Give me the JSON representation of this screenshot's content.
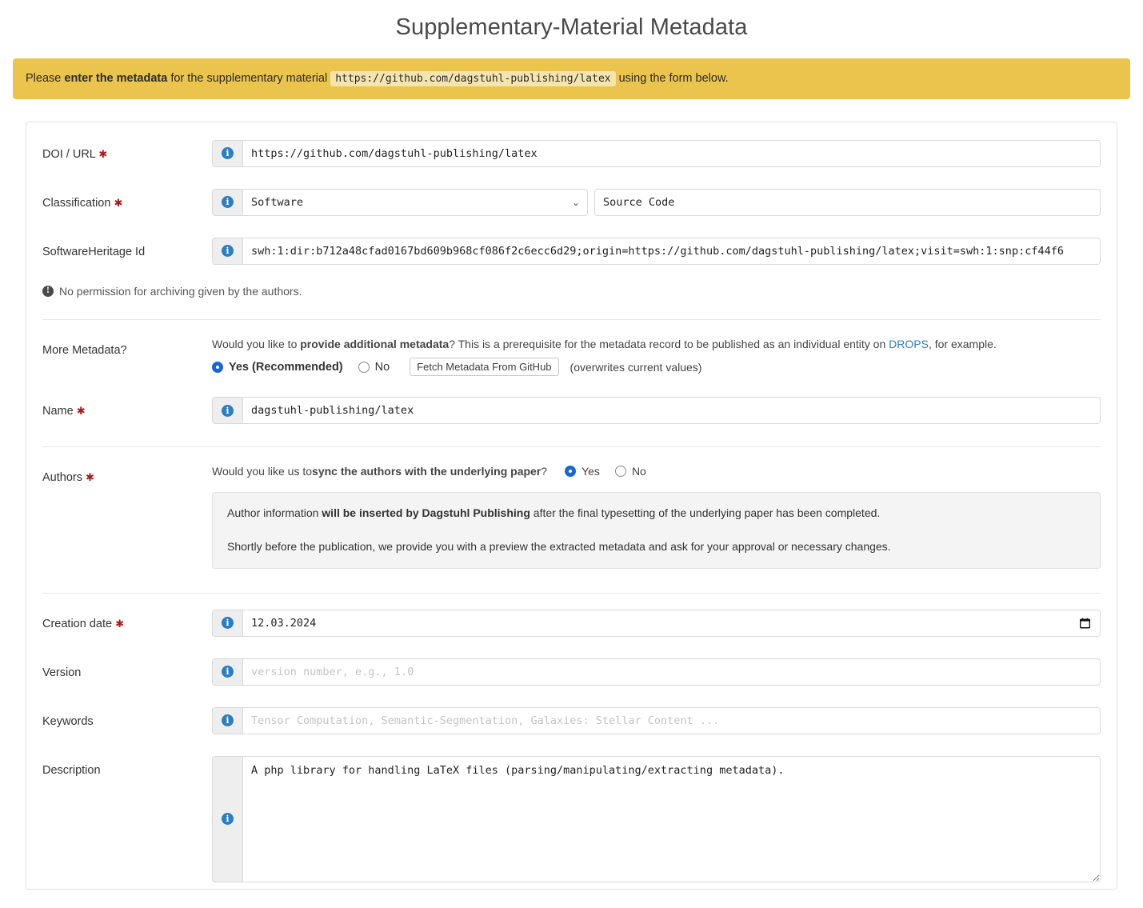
{
  "page": {
    "title": "Supplementary-Material Metadata"
  },
  "banner": {
    "lead": "Please ",
    "bold": "enter the metadata",
    "mid": " for the supplementary material ",
    "url_chip": "https://github.com/dagstuhl-publishing/latex",
    "tail": " using the form below.",
    "color": "#eac44c"
  },
  "fields": {
    "doi_url": {
      "label": "DOI / URL",
      "required_mark": "✱",
      "value": "https://github.com/dagstuhl-publishing/latex"
    },
    "classification": {
      "label": "Classification",
      "required_mark": "✱",
      "selected": "Software",
      "options": [
        "Software"
      ],
      "subtype_value": "Source Code"
    },
    "software_heritage_id": {
      "label": "SoftwareHeritage Id",
      "value": "swh:1:dir:b712a48cfad0167bd609b968cf086f2c6ecc6d29;origin=https://github.com/dagstuhl-publishing/latex;visit=swh:1:snp:cf44f6"
    },
    "permission_note": "No permission for archiving given by the authors.",
    "more_metadata": {
      "label": "More Metadata?",
      "question_pre": "Would you like to ",
      "question_bold": "provide additional metadata",
      "question_post": "? This is a prerequisite for the metadata record to be published as an individual entity on ",
      "link_text": "DROPS",
      "question_end": ", for example.",
      "option_yes": "Yes (Recommended)",
      "option_no": "No",
      "selected": "yes",
      "fetch_button": "Fetch Metadata From GitHub",
      "fetch_hint": "(overwrites current values)"
    },
    "name": {
      "label": "Name",
      "required_mark": "✱",
      "value": "dagstuhl-publishing/latex"
    },
    "authors": {
      "label": "Authors",
      "required_mark": "✱",
      "question_pre": "Would you like us to ",
      "question_bold": "sync the authors with the underlying paper",
      "question_post": "?",
      "option_yes": "Yes",
      "option_no": "No",
      "selected": "yes",
      "info_p1_pre": "Author information ",
      "info_p1_bold": "will be inserted by Dagstuhl Publishing",
      "info_p1_post": " after the final typesetting of the underlying paper has been completed.",
      "info_p2": "Shortly before the publication, we provide you with a preview the extracted metadata and ask for your approval or necessary changes."
    },
    "creation_date": {
      "label": "Creation date",
      "required_mark": "✱",
      "value": "12.03.2024"
    },
    "version": {
      "label": "Version",
      "value": "",
      "placeholder": "version number, e.g., 1.0"
    },
    "keywords": {
      "label": "Keywords",
      "value": "",
      "placeholder": "Tensor Computation, Semantic-Segmentation, Galaxies: Stellar Content ..."
    },
    "description": {
      "label": "Description",
      "value": "A php library for handling LaTeX files (parsing/manipulating/extracting metadata).",
      "placeholder": ""
    }
  },
  "icons": {
    "info": "i",
    "exclamation": "!",
    "chevron_down": "⌄"
  }
}
